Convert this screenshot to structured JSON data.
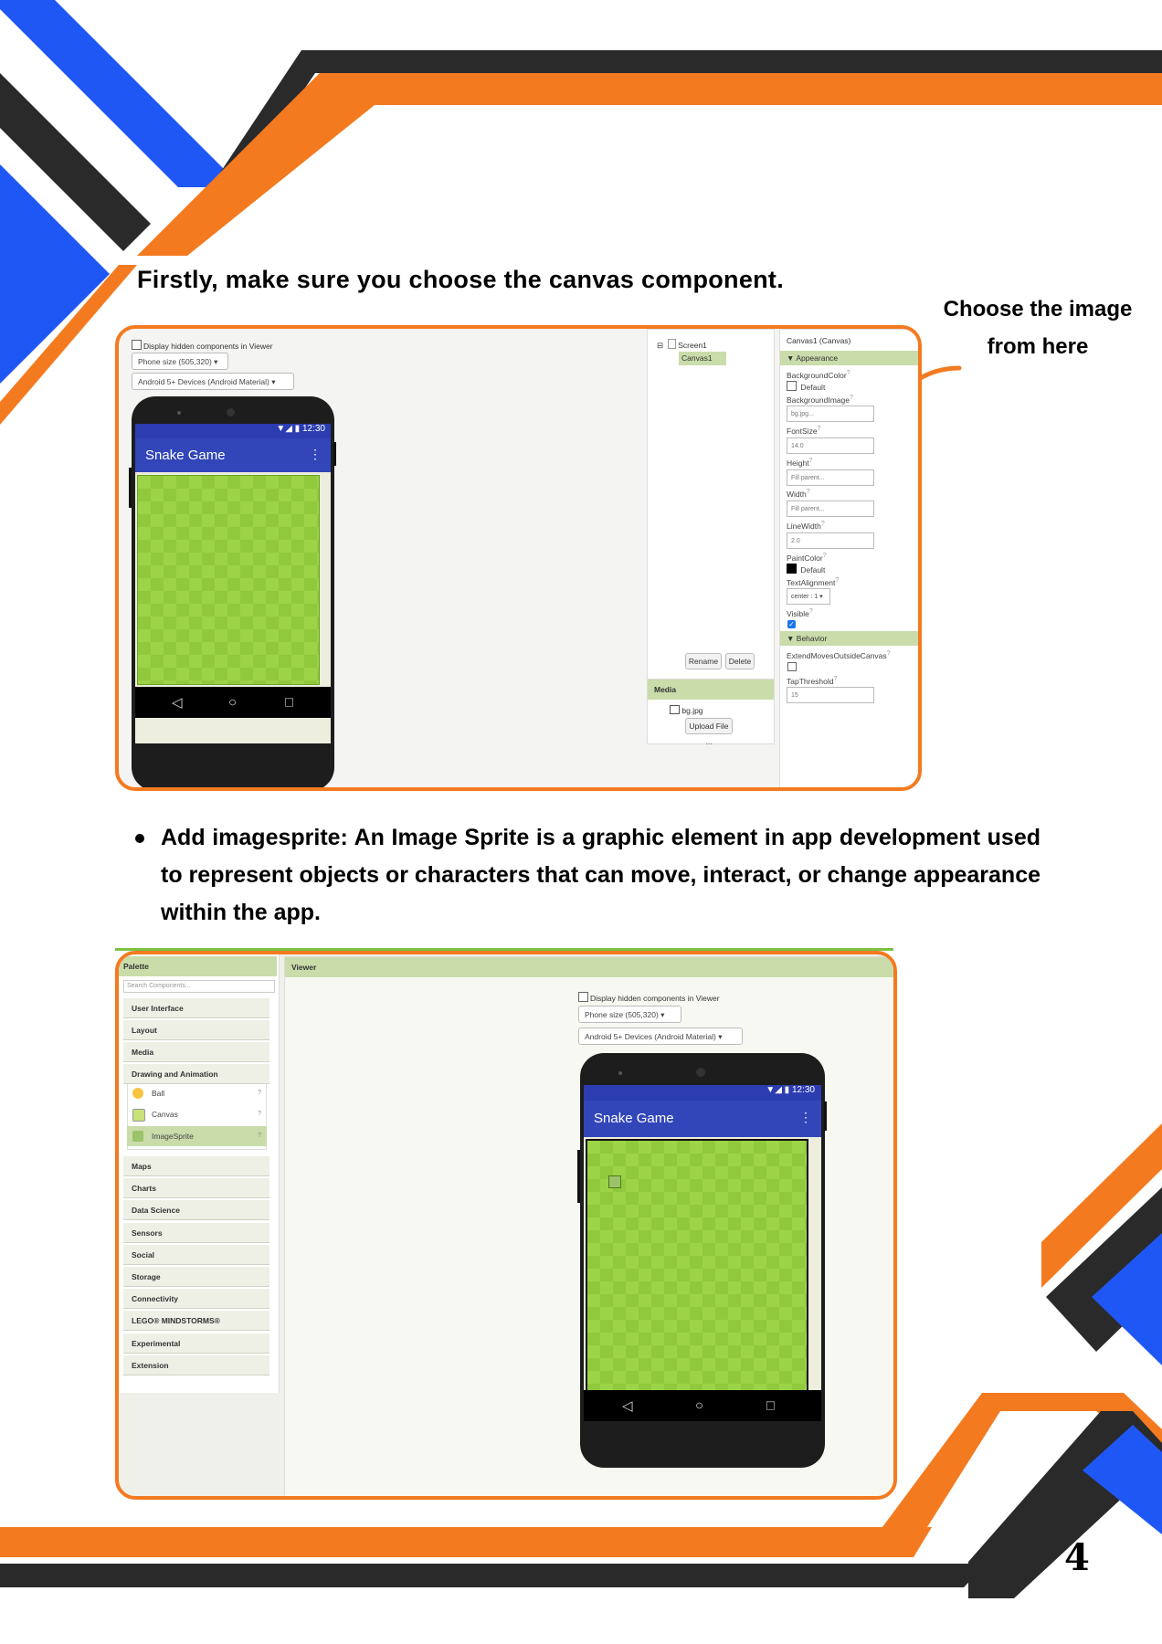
{
  "page": {
    "heading": "Firstly, make sure you choose the canvas component.",
    "callout": "Choose the image from here",
    "bullet_lead": "Add imagesprite:",
    "bullet_text": "An Image Sprite is a graphic element in app development used to represent objects or characters that can move, interact, or change appearance within the app.",
    "page_number": "4",
    "colors": {
      "orange": "#f47a20",
      "blue": "#1f57f5",
      "dark": "#2a2a2a"
    }
  },
  "shot1": {
    "display_hidden": "Display hidden components in Viewer",
    "phone_size": "Phone size (505,320)",
    "device": "Android 5+ Devices (Android Material)",
    "status_time": "12:30",
    "app_title": "Snake Game",
    "menu_icon": "more-vert-icon",
    "nav_back": "◁",
    "nav_home": "○",
    "nav_recent": "□",
    "tree": {
      "root": "Screen1",
      "child": "Canvas1"
    },
    "rename_button": "Rename",
    "delete_button": "Delete",
    "media_header": "Media",
    "media_file": "bg.jpg",
    "upload_button": "Upload File ...",
    "props_title": "Canvas1 (Canvas)",
    "appearance_header": "Appearance",
    "behavior_header": "Behavior",
    "props": {
      "bgcolor_label": "BackgroundColor",
      "bgcolor_value": "Default",
      "bgimage_label": "BackgroundImage",
      "bgimage_value": "bg.jpg...",
      "fontsize_label": "FontSize",
      "fontsize_value": "14.0",
      "height_label": "Height",
      "height_value": "Fill parent...",
      "width_label": "Width",
      "width_value": "Fill parent...",
      "linewidth_label": "LineWidth",
      "linewidth_value": "2.0",
      "paintcolor_label": "PaintColor",
      "paintcolor_value": "Default",
      "textalign_label": "TextAlignment",
      "textalign_value": "center : 1 ▾",
      "visible_label": "Visible",
      "extend_label": "ExtendMovesOutsideCanvas",
      "tap_label": "TapThreshold",
      "tap_value": "15",
      "help": "?"
    }
  },
  "shot2": {
    "palette_header": "Palette",
    "search_placeholder": "Search Components...",
    "viewer_header": "Viewer",
    "categories_top": [
      "User Interface",
      "Layout",
      "Media",
      "Drawing and Animation"
    ],
    "drawing_items": [
      "Ball",
      "Canvas",
      "ImageSprite"
    ],
    "categories_bottom": [
      "Maps",
      "Charts",
      "Data Science",
      "Sensors",
      "Social",
      "Storage",
      "Connectivity",
      "LEGO® MINDSTORMS®",
      "Experimental",
      "Extension"
    ],
    "display_hidden": "Display hidden components in Viewer",
    "phone_size": "Phone size (505,320)",
    "device": "Android 5+ Devices (Android Material)",
    "status_time": "12:30",
    "app_title": "Snake Game",
    "nav_back": "◁",
    "nav_home": "○",
    "nav_recent": "□",
    "help": "?"
  }
}
